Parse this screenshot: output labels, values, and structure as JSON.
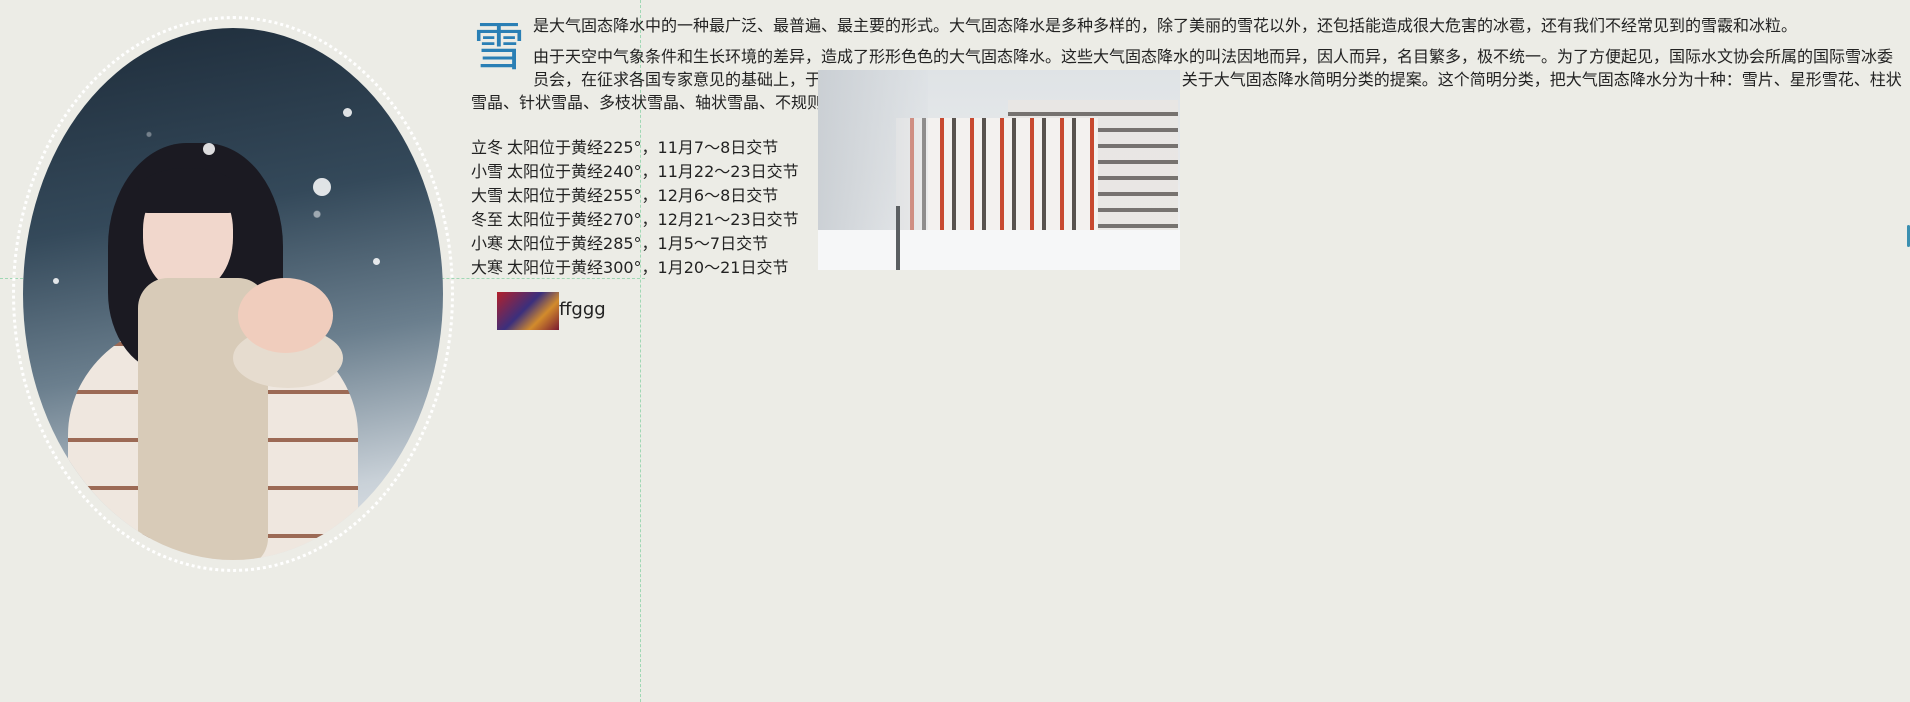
{
  "article": {
    "dropcap": "雪",
    "para1": "是大气固态降水中的一种最广泛、最普遍、最主要的形式。大气固态降水是多种多样的，除了美丽的雪花以外，还包括能造成很大危害的冰雹，还有我们不经常见到的雪霰和冰粒。",
    "para2": "由于天空中气象条件和生长环境的差异，造成了形形色色的大气固态降水。这些大气固态降水的叫法因地而异，因人而异，名目繁多，极不统一。为了方便起见，国际水文协会所属的国际雪冰委员会，在征求各国专家意见的基础上，于1949年召开了一个专门性的国际会议，会上通过了关于大气固态降水简明分类的提案。这个简明分类，把大气固态降水分为十种：雪片、星形雪花、柱状雪晶、针状雪晶、多枝状雪晶、轴状雪晶、不规则雪晶、霰、冰粒和雹。前面的七种统称为雪。"
  },
  "solar_terms": [
    {
      "name": "立冬",
      "desc": "太阳位于黄经225°，11月7～8日交节"
    },
    {
      "name": "小雪",
      "desc": "太阳位于黄经240°，11月22～23日交节"
    },
    {
      "name": "大雪",
      "desc": "太阳位于黄经255°，12月6～8日交节"
    },
    {
      "name": "冬至",
      "desc": "太阳位于黄经270°，12月21～23日交节"
    },
    {
      "name": "小寒",
      "desc": "太阳位于黄经285°，1月5～7日交节"
    },
    {
      "name": "大寒",
      "desc": "太阳位于黄经300°，1月20～21日交节"
    }
  ],
  "avatar_caption": "ffggg",
  "colors": {
    "background": "#ecece6",
    "dropcap": "#2a7fb5",
    "guide": "#9fd8b4"
  }
}
